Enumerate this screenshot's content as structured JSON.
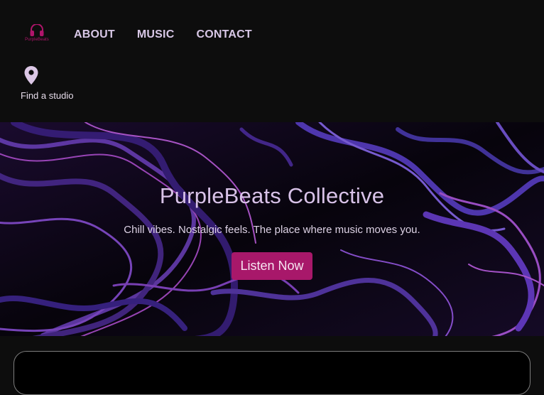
{
  "brand": {
    "name": "PurpleBeats",
    "logo_icon": "headphones-icon",
    "logo_color": "#b0156b"
  },
  "nav": {
    "items": [
      {
        "label": "ABOUT"
      },
      {
        "label": "MUSIC"
      },
      {
        "label": "CONTACT"
      }
    ]
  },
  "studio_finder": {
    "icon": "location-pin-icon",
    "label": "Find a studio"
  },
  "hero": {
    "title": "PurpleBeats Collective",
    "subtitle": "Chill vibes. Nostalgic feels. The place where music moves you.",
    "cta_label": "Listen Now",
    "cta_color": "#a8186a"
  },
  "colors": {
    "background": "#0d0d0d",
    "accent_purple": "#8a4fd6",
    "accent_pink": "#c24fd0"
  }
}
